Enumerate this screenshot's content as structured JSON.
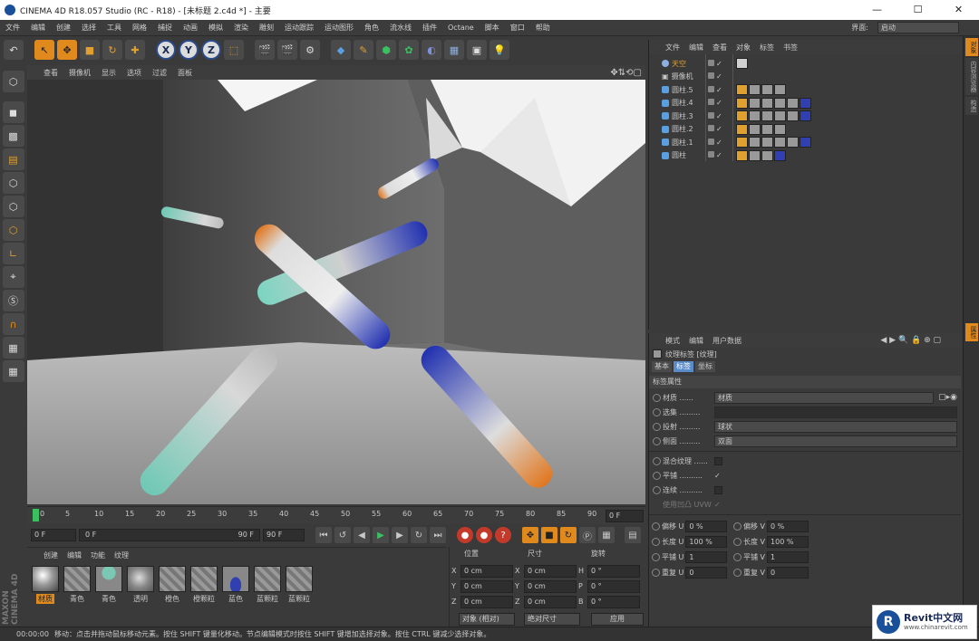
{
  "window": {
    "title": "CINEMA 4D R18.057 Studio (RC - R18) - [未标题 2.c4d *] - 主要",
    "min": "—",
    "max": "☐",
    "close": "✕"
  },
  "menubar": {
    "items": [
      "文件",
      "编辑",
      "创建",
      "选择",
      "工具",
      "网格",
      "捕捉",
      "动画",
      "模拟",
      "渲染",
      "雕刻",
      "运动跟踪",
      "运动图形",
      "角色",
      "流水线",
      "插件",
      "Octane",
      "脚本",
      "窗口",
      "帮助"
    ],
    "layout_label": "界面:",
    "layout_value": "启动"
  },
  "toolbar": {
    "x": "X",
    "y": "Y",
    "z": "Z"
  },
  "viewport": {
    "menu": [
      "查看",
      "摄像机",
      "显示",
      "选项",
      "过滤",
      "面板"
    ]
  },
  "timeline": {
    "ticks": [
      "0",
      "5",
      "10",
      "15",
      "20",
      "25",
      "30",
      "35",
      "40",
      "45",
      "50",
      "55",
      "60",
      "65",
      "70",
      "75",
      "80",
      "85",
      "90"
    ],
    "end_field": "0 F"
  },
  "playbar": {
    "current": "0 F",
    "min": "0 F",
    "max": "90 F",
    "end": "90 F"
  },
  "materials": {
    "menu": [
      "创建",
      "编辑",
      "功能",
      "纹理"
    ],
    "items": [
      {
        "label": "材质",
        "color": "#c8c8c8"
      },
      {
        "label": "青色",
        "color": "#7ac8b4"
      },
      {
        "label": "青色",
        "color": "#5ab4a0"
      },
      {
        "label": "透明",
        "color": "#a0a0a0"
      },
      {
        "label": "橙色",
        "color": "#e08a3a"
      },
      {
        "label": "橙颗粒",
        "color": "#d07a3a"
      },
      {
        "label": "蓝色",
        "color": "#3040b0"
      },
      {
        "label": "蓝颗粒",
        "color": "#4050b8"
      },
      {
        "label": "蓝颗粒",
        "color": "#4a5ac0"
      }
    ]
  },
  "coordinates": {
    "headers": [
      "位置",
      "尺寸",
      "旋转"
    ],
    "rows": [
      {
        "a": "X",
        "av": "0 cm",
        "b": "X",
        "bv": "0 cm",
        "c": "H",
        "cv": "0 °"
      },
      {
        "a": "Y",
        "av": "0 cm",
        "b": "Y",
        "bv": "0 cm",
        "c": "P",
        "cv": "0 °"
      },
      {
        "a": "Z",
        "av": "0 cm",
        "b": "Z",
        "bv": "0 cm",
        "c": "B",
        "cv": "0 °"
      }
    ],
    "mode1": "对象 (相对)",
    "mode2": "绝对尺寸",
    "apply": "应用"
  },
  "objects": {
    "menu": [
      "文件",
      "编辑",
      "查看",
      "对象",
      "标签",
      "书签"
    ],
    "rows": [
      {
        "name": "天空",
        "highlight": true
      },
      {
        "name": "摄像机",
        "highlight": false
      },
      {
        "name": "圆柱.5",
        "highlight": false
      },
      {
        "name": "圆柱.4",
        "highlight": false
      },
      {
        "name": "圆柱.3",
        "highlight": false
      },
      {
        "name": "圆柱.2",
        "highlight": false
      },
      {
        "name": "圆柱.1",
        "highlight": false
      },
      {
        "name": "圆柱",
        "highlight": false
      }
    ]
  },
  "attributes": {
    "menu": [
      "模式",
      "编辑",
      "用户数据"
    ],
    "title": "纹理标签 [纹理]",
    "tabs": [
      "基本",
      "标签",
      "坐标"
    ],
    "section": "标签属性",
    "material_label": "材质 ......",
    "material_value": "材质",
    "selection_label": "选集 .........",
    "projection_label": "投射 .........",
    "projection_value": "球状",
    "side_label": "侧面 .........",
    "side_value": "双面",
    "mix_label": "混合纹理 ......",
    "tile_label": "平铺 ..........",
    "tile_check": "✓",
    "seam_label": "连续 ..........",
    "uvw_label": "使用凹凸 UVW",
    "uvw_check": "✓",
    "uv": [
      {
        "l1": "偏移 U",
        "v1": "0 %",
        "l2": "偏移 V",
        "v2": "0 %"
      },
      {
        "l1": "长度 U",
        "v1": "100 %",
        "l2": "长度 V",
        "v2": "100 %"
      },
      {
        "l1": "平铺 U",
        "v1": "1",
        "l2": "平铺 V",
        "v2": "1"
      },
      {
        "l1": "重复 U",
        "v1": "0",
        "l2": "重复 V",
        "v2": "0"
      }
    ]
  },
  "rightstrip": [
    "对象",
    "内容浏览器",
    "构造",
    "属性"
  ],
  "status": {
    "time": "00:00:00",
    "text": "移动：点击并拖动鼠标移动元素。按住 SHIFT 键量化移动。节点编辑模式时按住 SHIFT 键增加选择对象。按住 CTRL 键减少选择对象。"
  },
  "watermark": {
    "title": "Revit中文网",
    "url": "www.chinarevit.com"
  }
}
